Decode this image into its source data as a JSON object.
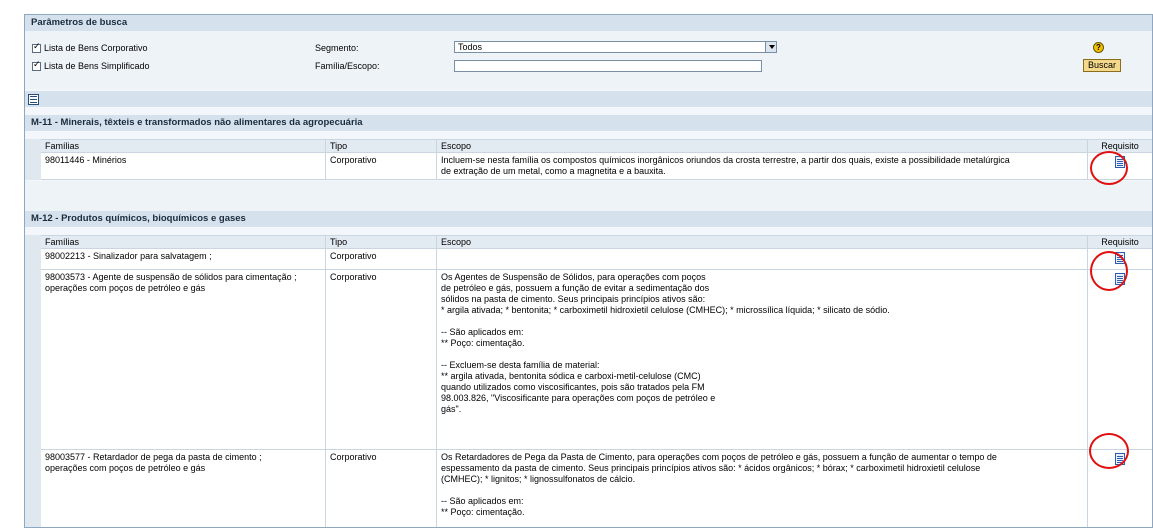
{
  "params": {
    "title": "Parâmetros de busca",
    "check1_label": "Lista de Bens Corporativo",
    "check2_label": "Lista de Bens Simplificado",
    "segmento_label": "Segmento:",
    "segmento_value": "Todos",
    "familia_label": "Família/Escopo:",
    "familia_value": "",
    "buscar_label": "Buscar"
  },
  "columns": {
    "familias": "Famílias",
    "tipo": "Tipo",
    "escopo": "Escopo",
    "requisito": "Requisito"
  },
  "sections": [
    {
      "title": "M-11 - Minerais, têxteis e transformados não alimentares da agropecuária",
      "rows": [
        {
          "familia": "98011446 - Minérios",
          "tipo": "Corporativo",
          "escopo": "Incluem-se nesta família os compostos químicos inorgânicos oriundos da crosta terrestre, a partir dos quais, existe a possibilidade metalúrgica\nde extração de um metal, como a magnetita e a bauxita."
        }
      ]
    },
    {
      "title": "M-12 - Produtos químicos, bioquímicos e gases",
      "rows": [
        {
          "familia": "98002213 - Sinalizador para salvatagem ;",
          "tipo": "Corporativo",
          "escopo": ""
        },
        {
          "familia": "98003573 - Agente de suspensão de sólidos para cimentação ;\noperações com poços de petróleo e gás",
          "tipo": "Corporativo",
          "escopo": "Os Agentes de Suspensão de Sólidos, para operações com poços\nde petróleo e gás, possuem a função de evitar a sedimentação dos\nsólidos na pasta de cimento. Seus principais princípios ativos são:\n* argila ativada; * bentonita; * carboximetil hidroxietil celulose (CMHEC); * microssílica líquida; * silicato de sódio.\n\n-- São aplicados em:\n** Poço: cimentação.\n\n-- Excluem-se desta família de material:\n** argila ativada, bentonita sódica e carboxi-metil-celulose (CMC)\nquando utilizados como viscosificantes, pois são tratados pela FM\n98.003.826, \"Viscosificante para operações com poços de petróleo e\ngás\"."
        },
        {
          "familia": "98003577 - Retardador de pega da pasta de cimento ;\noperações com poços de petróleo e gás",
          "tipo": "Corporativo",
          "escopo": "Os Retardadores de Pega da Pasta de Cimento, para operações com poços de petróleo e gás, possuem a função de aumentar o tempo de\nespessamento da pasta de cimento. Seus principais princípios ativos são: * ácidos orgânicos; * bórax; * carboximetil hidroxietil celulose\n(CMHEC); * lignitos; * lignossulfonatos de cálcio.\n\n-- São aplicados em:\n** Poço: cimentação."
        }
      ]
    }
  ],
  "colors": {
    "header_bg": "#d5e2ee",
    "button_bg": "#f5d98a",
    "highlight_circle": "#e01010"
  }
}
